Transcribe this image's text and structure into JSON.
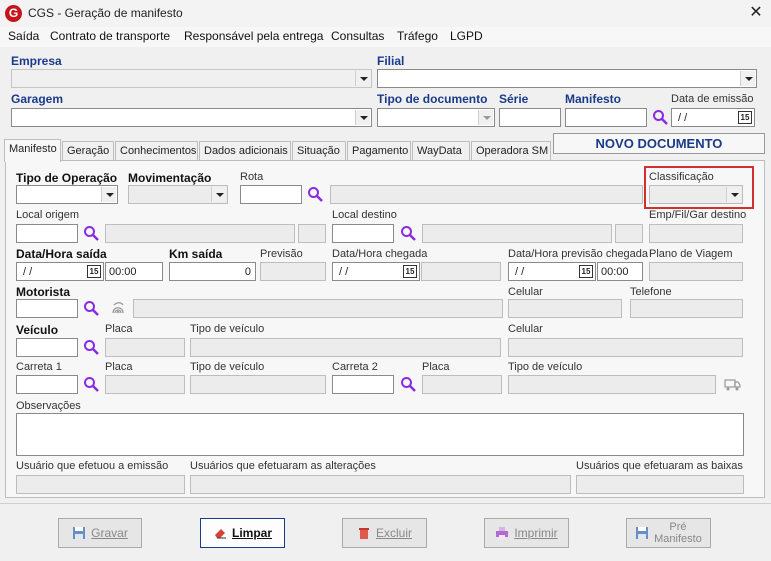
{
  "window": {
    "title": "CGS - Geração de manifesto",
    "app_icon": "G",
    "close": "✕"
  },
  "menu": [
    "Saída",
    "Contrato de transporte",
    "Responsável pela entrega",
    "Consultas",
    "Tráfego",
    "LGPD"
  ],
  "header": {
    "empresa_label": "Empresa",
    "filial_label": "Filial",
    "garagem_label": "Garagem",
    "tipo_documento_label": "Tipo de documento",
    "serie_label": "Série",
    "manifesto_label": "Manifesto",
    "data_emissao_label": "Data de emissão",
    "data_emissao_value": " /  /"
  },
  "tabs": [
    "Manifesto",
    "Geração",
    "Conhecimentos",
    "Dados adicionais",
    "Situação",
    "Pagamento",
    "WayData",
    "Operadora SM"
  ],
  "new_document_label": "NOVO DOCUMENTO",
  "form": {
    "tipo_operacao": "Tipo de Operação",
    "movimentacao": "Movimentação",
    "rota": "Rota",
    "classificacao": "Classificação",
    "local_origem": "Local origem",
    "local_destino": "Local destino",
    "emp_fil_gar_destino": "Emp/Fil/Gar destino",
    "data_hora_saida": "Data/Hora saída",
    "data_saida_value": " /  /",
    "hora_saida_value": "00:00",
    "km_saida": "Km saída",
    "km_saida_value": "0",
    "previsao": "Previsão",
    "data_hora_chegada": "Data/Hora chegada",
    "data_chegada_value": " /  /",
    "data_hora_prev_chegada": "Data/Hora previsão chegada",
    "data_prev_value": " /  /",
    "hora_prev_value": "00:00",
    "plano_viagem": "Plano de Viagem",
    "motorista": "Motorista",
    "celular": "Celular",
    "telefone": "Telefone",
    "veiculo": "Veículo",
    "placa": "Placa",
    "tipo_veiculo": "Tipo de veículo",
    "carreta1": "Carreta 1",
    "carreta2": "Carreta 2",
    "observacoes": "Observações",
    "usuario_emissao": "Usuário que efetuou a emissão",
    "usuarios_alteracoes": "Usuários que efetuaram as alterações",
    "usuarios_baixas": "Usuários que efetuaram as baixas"
  },
  "buttons": {
    "gravar": "Gravar",
    "limpar": "Limpar",
    "excluir": "Excluir",
    "imprimir": "Imprimir",
    "pre_manifesto_1": "Pré",
    "pre_manifesto_2": "Manifesto"
  },
  "colors": {
    "accent": "#1a3a8a",
    "search_icon": "#8a2be2",
    "highlight": "#d32f2f",
    "app_icon": "#c5161d"
  }
}
